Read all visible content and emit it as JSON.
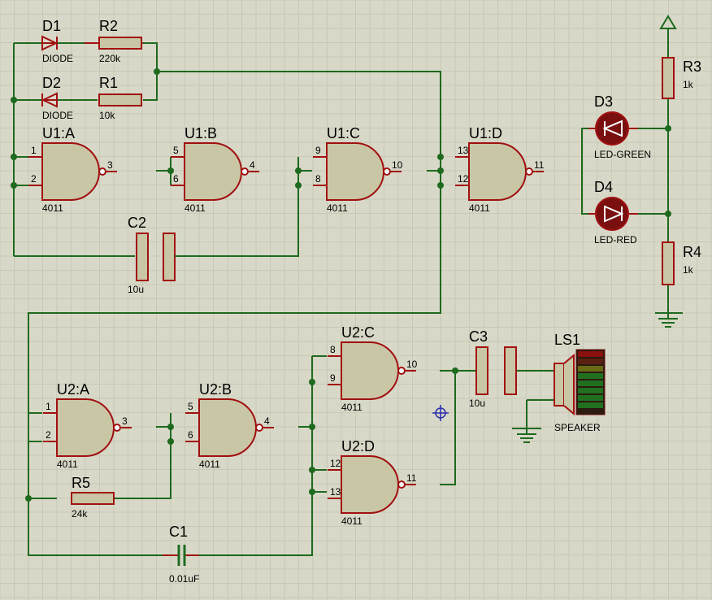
{
  "components": {
    "D1": {
      "ref": "D1",
      "value": "DIODE"
    },
    "D2": {
      "ref": "D2",
      "value": "DIODE"
    },
    "R1": {
      "ref": "R1",
      "value": "10k"
    },
    "R2": {
      "ref": "R2",
      "value": "220k"
    },
    "R3": {
      "ref": "R3",
      "value": "1k"
    },
    "R4": {
      "ref": "R4",
      "value": "1k"
    },
    "R5": {
      "ref": "R5",
      "value": "24k"
    },
    "C1": {
      "ref": "C1",
      "value": "0.01uF"
    },
    "C2": {
      "ref": "C2",
      "value": "10u"
    },
    "C3": {
      "ref": "C3",
      "value": "10u"
    },
    "D3": {
      "ref": "D3",
      "value": "LED-GREEN"
    },
    "D4": {
      "ref": "D4",
      "value": "LED-RED"
    },
    "LS1": {
      "ref": "LS1",
      "value": "SPEAKER"
    }
  },
  "gates": [
    {
      "ref": "U1:A",
      "value": "4011",
      "pin_in1": "1",
      "pin_in2": "2",
      "pin_out": "3"
    },
    {
      "ref": "U1:B",
      "value": "4011",
      "pin_in1": "5",
      "pin_in2": "6",
      "pin_out": "4"
    },
    {
      "ref": "U1:C",
      "value": "4011",
      "pin_in1": "9",
      "pin_in2": "8",
      "pin_out": "10"
    },
    {
      "ref": "U1:D",
      "value": "4011",
      "pin_in1": "13",
      "pin_in2": "12",
      "pin_out": "11"
    },
    {
      "ref": "U2:A",
      "value": "4011",
      "pin_in1": "1",
      "pin_in2": "2",
      "pin_out": "3"
    },
    {
      "ref": "U2:B",
      "value": "4011",
      "pin_in1": "5",
      "pin_in2": "6",
      "pin_out": "4"
    },
    {
      "ref": "U2:C",
      "value": "4011",
      "pin_in1": "8",
      "pin_in2": "9",
      "pin_out": "10"
    },
    {
      "ref": "U2:D",
      "value": "4011",
      "pin_in1": "12",
      "pin_in2": "13",
      "pin_out": "11"
    }
  ],
  "colors": {
    "background": "#d8d8c8",
    "grid": "#c9c9b6",
    "wire": "#1e6a1e",
    "component_outline": "#a01010",
    "component_body": "#c9c6a6",
    "led": "#8b0000"
  }
}
